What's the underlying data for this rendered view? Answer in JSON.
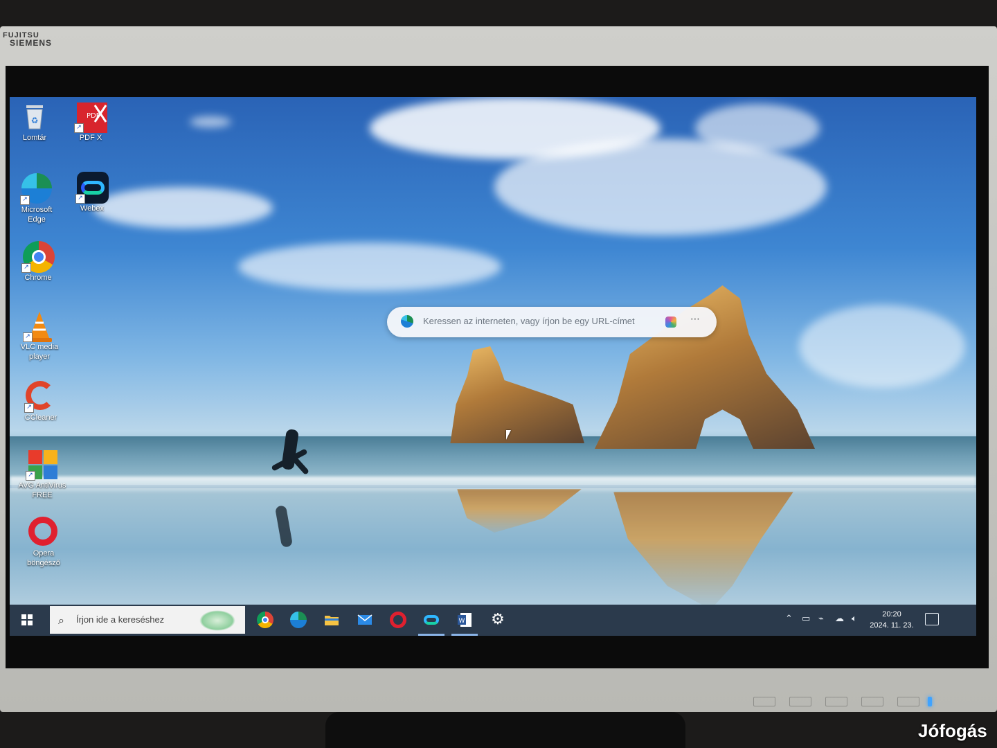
{
  "monitor": {
    "brand_line1": "FUJITSU",
    "brand_line2": "SIEMENS"
  },
  "desktop": {
    "icons": [
      {
        "label": "Lomtár",
        "icon": "recycle-bin-icon"
      },
      {
        "label": "PDF X",
        "icon": "pdfx-icon"
      },
      {
        "label": "Microsoft Edge",
        "icon": "edge-icon"
      },
      {
        "label": "Webex",
        "icon": "webex-icon"
      },
      {
        "label": "Chrome",
        "icon": "chrome-icon"
      },
      {
        "label": "VLC media player",
        "icon": "vlc-icon"
      },
      {
        "label": "CCleaner",
        "icon": "ccleaner-icon"
      },
      {
        "label": "AVG AntiVirus FREE",
        "icon": "avg-icon"
      },
      {
        "label": "Opera böngésző",
        "icon": "opera-icon"
      }
    ]
  },
  "edge_search": {
    "placeholder": "Keressen az interneten, vagy írjon be egy URL-címet",
    "more": "⋯"
  },
  "taskbar": {
    "search_placeholder": "Írjon ide a kereséshez",
    "apps": [
      "chrome-icon",
      "edge-icon",
      "file-explorer-icon",
      "mail-icon",
      "opera-icon",
      "webex-icon",
      "word-icon",
      "settings-icon"
    ],
    "active_apps": [
      "webex-icon",
      "word-icon"
    ],
    "time": "20:20",
    "date": "2024. 11. 23."
  },
  "watermark": "Jófogás",
  "colors": {
    "taskbar": "#2b3a4c",
    "accent": "#8ab4e8",
    "led": "#3fa3ff"
  }
}
